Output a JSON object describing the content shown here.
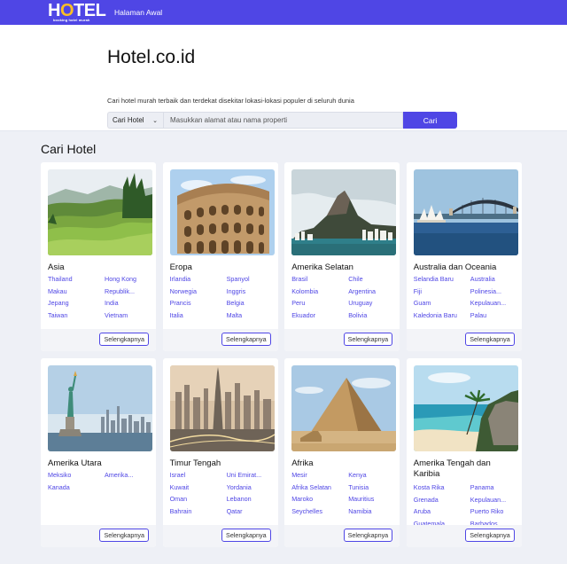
{
  "navbar": {
    "logo_text_a": "H",
    "logo_text_o": "O",
    "logo_text_b": "TEL",
    "logo_tagline": "booking hotel murah",
    "home_link": "Halaman Awal"
  },
  "hero": {
    "title": "Hotel.co.id",
    "subtitle": "Cari hotel murah terbaik dan terdekat disekitar lokasi-lokasi populer di seluruh dunia",
    "search_type": "Cari Hotel",
    "search_placeholder": "Masukkan alamat atau nama properti",
    "search_button": "Cari"
  },
  "section_title": "Cari Hotel",
  "more_label": "Selengkapnya",
  "regions": [
    {
      "name": "Asia",
      "image": "rice-terraces-photo",
      "links": [
        "Thailand",
        "Hong Kong",
        "Makau",
        "Republik...",
        "Jepang",
        "India",
        "Taiwan",
        "Vietnam"
      ]
    },
    {
      "name": "Eropa",
      "image": "colosseum-photo",
      "links": [
        "Irlandia",
        "Spanyol",
        "Norwegia",
        "Inggris",
        "Prancis",
        "Belgia",
        "Italia",
        "Malta"
      ]
    },
    {
      "name": "Amerika Selatan",
      "image": "rio-mountain-photo",
      "links": [
        "Brasil",
        "Chile",
        "Kolombia",
        "Argentina",
        "Peru",
        "Uruguay",
        "Ekuador",
        "Bolivia"
      ]
    },
    {
      "name": "Australia dan Oceania",
      "image": "sydney-harbour-photo",
      "links": [
        "Selandia Baru",
        "Australia",
        "Fiji",
        "Polinesia...",
        "Guam",
        "Kepulauan...",
        "Kaledonia Baru",
        "Palau"
      ]
    },
    {
      "name": "Amerika Utara",
      "image": "statue-of-liberty-photo",
      "links": [
        "Meksiko",
        "Amerika...",
        "Kanada"
      ]
    },
    {
      "name": "Timur Tengah",
      "image": "dubai-skyline-photo",
      "links": [
        "Israel",
        "Uni Emirat...",
        "Kuwait",
        "Yordania",
        "Oman",
        "Lebanon",
        "Bahrain",
        "Qatar"
      ]
    },
    {
      "name": "Afrika",
      "image": "pyramids-photo",
      "links": [
        "Mesir",
        "Kenya",
        "Afrika Selatan",
        "Tunisia",
        "Maroko",
        "Mauritius",
        "Seychelles",
        "Namibia"
      ]
    },
    {
      "name": "Amerika Tengah dan Karibia",
      "image": "tropical-beach-photo",
      "links": [
        "Kosta Rika",
        "Panama",
        "Grenada",
        "Kepulauan...",
        "Aruba",
        "Puerto Riko",
        "Guatemala",
        "Barbados"
      ]
    }
  ],
  "colors": {
    "primary": "#4f46e5",
    "logo_accent": "#fbbf24",
    "page_bg": "#eef0f6"
  }
}
